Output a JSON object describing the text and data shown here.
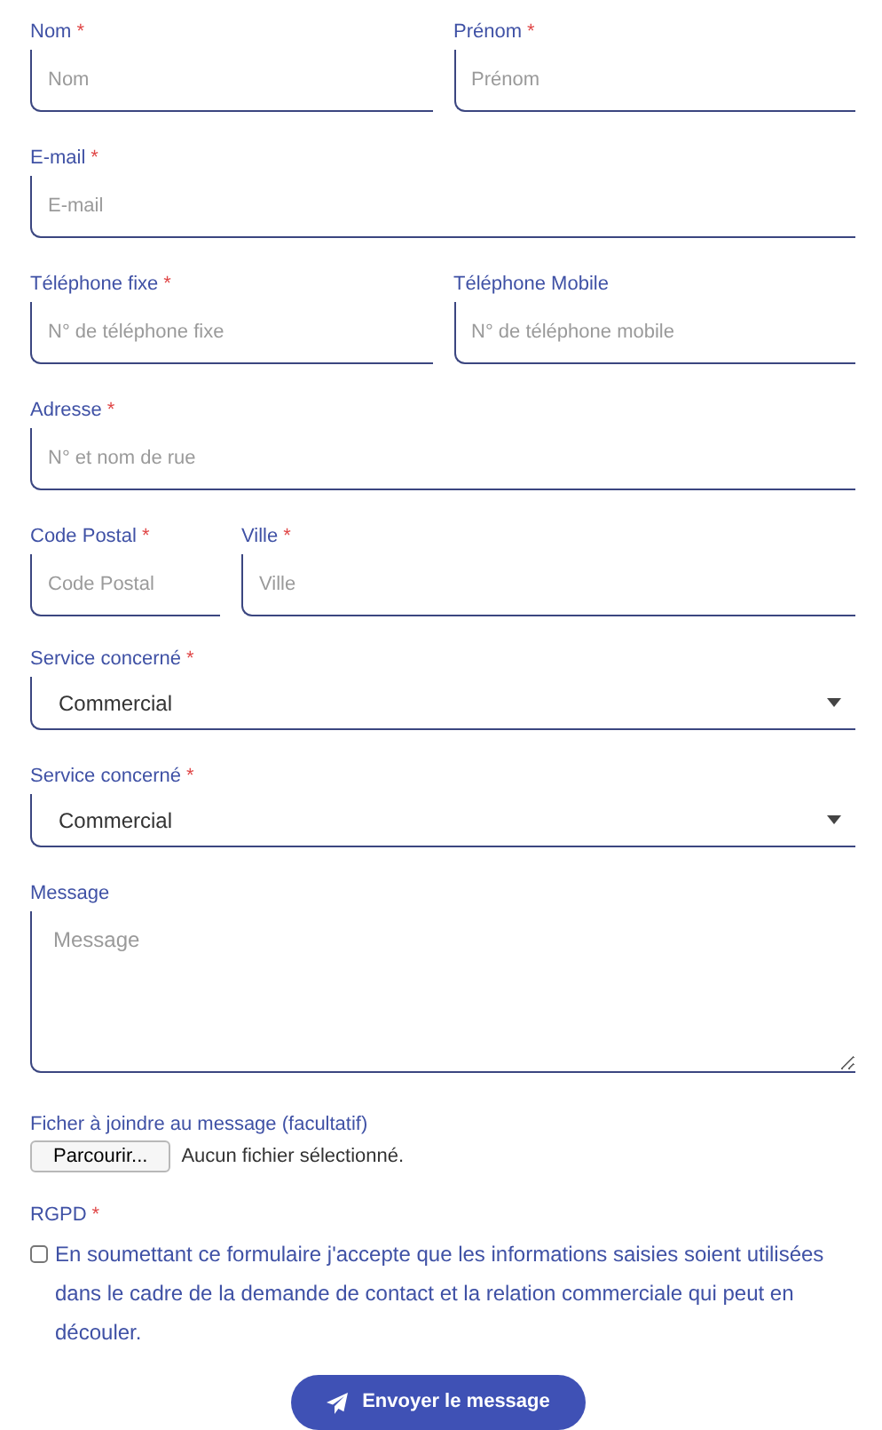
{
  "rows": [
    {
      "fields": [
        {
          "kind": "text",
          "label": "Nom",
          "mark": "*",
          "placeholder": "Nom"
        },
        {
          "kind": "text",
          "label": "Prénom",
          "mark": "*",
          "placeholder": "Prénom"
        }
      ]
    },
    {
      "fields": [
        {
          "kind": "text",
          "label": "E-mail",
          "mark": "*",
          "placeholder": "E-mail"
        }
      ]
    },
    {
      "fields": [
        {
          "kind": "text",
          "label": "Téléphone fixe",
          "mark": "*",
          "placeholder": "N° de téléphone fixe"
        },
        {
          "kind": "text",
          "label": "Téléphone Mobile",
          "placeholder": "N° de téléphone mobile"
        }
      ]
    },
    {
      "fields": [
        {
          "kind": "text",
          "label": "Adresse",
          "mark": "*",
          "placeholder": "N° et nom de rue"
        }
      ]
    },
    {
      "fields": [
        {
          "kind": "text",
          "label": "Code Postal",
          "mark": "*",
          "placeholder": "Code Postal"
        },
        {
          "kind": "text",
          "label": "Ville",
          "mark": "*",
          "placeholder": "Ville"
        }
      ]
    },
    {
      "fields": [
        {
          "kind": "select",
          "label": "Service concerné",
          "mark": "*",
          "value": "Commercial"
        }
      ]
    },
    {
      "fields": [
        {
          "kind": "select",
          "label": "Service concerné",
          "mark": "*",
          "value": "Commercial"
        }
      ]
    },
    {
      "fields": [
        {
          "kind": "textarea",
          "label": "Message",
          "placeholder": "Message"
        }
      ]
    }
  ],
  "attachment": {
    "label": "Ficher à joindre au message (facultatif)",
    "button": "Parcourir...",
    "status": "Aucun fichier sélectionné."
  },
  "consent": {
    "label": "RGPD",
    "mark": "*",
    "checked": false,
    "text": "En soumettant ce formulaire j'accepte que les informations saisies soient utilisées dans le cadre de la demande de contact et la relation commerciale qui peut en découler."
  },
  "submit": {
    "label": "Envoyer le message"
  }
}
